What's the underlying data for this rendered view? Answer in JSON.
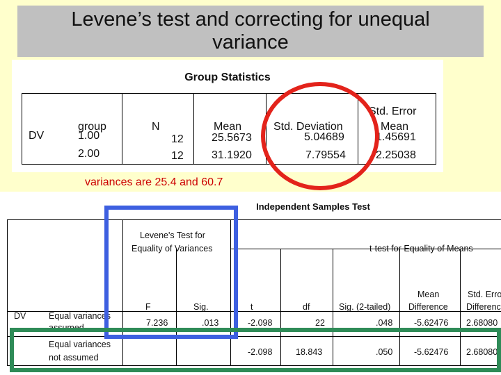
{
  "title": {
    "line1": "Levene’s test and correcting for unequal",
    "line2": "variance"
  },
  "group_stats": {
    "caption": "Group Statistics",
    "headers": {
      "group": "group",
      "n": "N",
      "mean": "Mean",
      "sd": "Std. Deviation",
      "se_line1": "Std. Error",
      "se_line2": "Mean"
    },
    "dv": "DV",
    "rows": [
      {
        "group": "1.00",
        "n": "12",
        "mean": "25.5673",
        "sd": "5.04689",
        "se": "1.45691"
      },
      {
        "group": "2.00",
        "n": "12",
        "mean": "31.1920",
        "sd": "7.79554",
        "se": "2.25038"
      }
    ]
  },
  "note": "variances are 25.4 and 60.7",
  "ind_test": {
    "caption": "Independent Samples Test",
    "levene_line1": "Levene's Test for",
    "levene_line2": "Equality of Variances",
    "ttest_header": "t-test for Equality of Means",
    "headers": {
      "f": "F",
      "sig": "Sig.",
      "t": "t",
      "df": "df",
      "sig2": "Sig. (2-tailed)",
      "md_line1": "Mean",
      "md_line2": "Difference",
      "sed_line1": "Std. Error",
      "sed_line2": "Difference"
    },
    "dv": "DV",
    "rows": [
      {
        "label_line1": "Equal variances",
        "label_line2": "assumed",
        "f": "7.236",
        "sig": ".013",
        "t": "-2.098",
        "df": "22",
        "sig2": ".048",
        "md": "-5.62476",
        "sed": "2.68080"
      },
      {
        "label_line1": "Equal variances",
        "label_line2": "not assumed",
        "f": "",
        "sig": "",
        "t": "-2.098",
        "df": "18.843",
        "sig2": ".050",
        "md": "-5.62476",
        "sed": "2.68080"
      }
    ]
  },
  "colors": {
    "red_circle": "#e3231b",
    "blue_box": "#3d5fe0",
    "green_box": "#2e8b57",
    "background": "#ffffcc",
    "title_bg": "#c0c0c0",
    "note": "#cc0000"
  }
}
